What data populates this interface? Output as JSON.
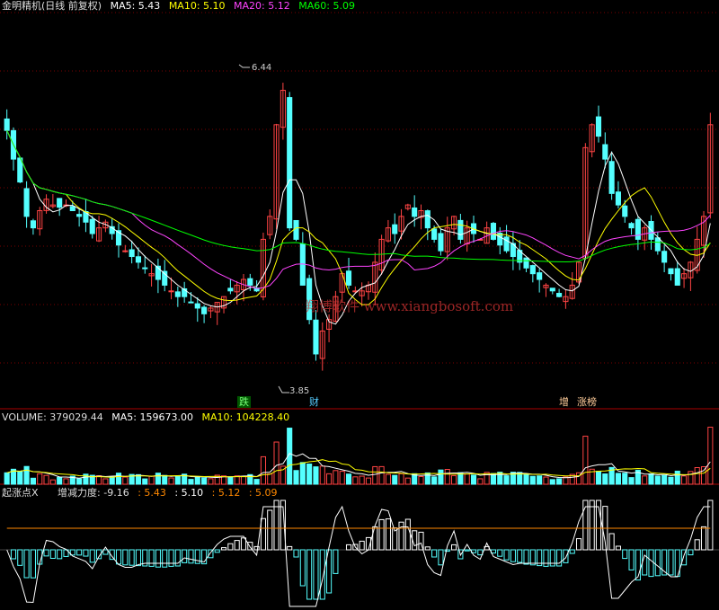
{
  "colors": {
    "up": "#ff4444",
    "down": "#54ffff",
    "ma5": "#ffffff",
    "ma10": "#ffff00",
    "ma20": "#ff44ff",
    "ma60": "#00ff00",
    "vol_ma5": "#ffffff",
    "vol_ma10": "#ffff00",
    "grid": "#7a0000"
  },
  "header": {
    "title": "金明精机(日线 前复权)",
    "ma5": "MA5: 5.43",
    "ma10": "MA10: 5.10",
    "ma20": "MA20: 5.12",
    "ma60": "MA60: 5.09"
  },
  "annotations": {
    "high": "6.44",
    "low": "3.85"
  },
  "event_tags": {
    "t1": "跌",
    "t2": "财",
    "t3": "增",
    "t4": "涨榜"
  },
  "watermark": "翔博软件 www.xiangbosoft.com",
  "volume_header": {
    "volume": "VOLUME: 379029.44",
    "ma5": "MA5: 159673.00",
    "ma10": "MA10: 104228.40"
  },
  "indicator_header": {
    "name": "起涨点X",
    "label": "增减力度: -9.16",
    "v1": ": 5.43",
    "v2": ": 5.10",
    "v3": ": 5.12",
    "v4": ": 5.09"
  },
  "chart_data": {
    "type": "candlestick",
    "price_range": [
      3.6,
      6.9
    ],
    "closes": [
      5.95,
      5.7,
      5.5,
      5.2,
      5.1,
      5.25,
      5.35,
      5.3,
      5.28,
      5.3,
      5.25,
      5.2,
      5.15,
      5.05,
      5.1,
      5.15,
      5.05,
      4.95,
      4.9,
      4.85,
      4.8,
      4.75,
      4.7,
      4.65,
      4.6,
      4.55,
      4.5,
      4.5,
      4.45,
      4.4,
      4.35,
      4.4,
      4.45,
      4.5,
      4.55,
      4.6,
      4.65,
      4.6,
      4.55,
      5.0,
      5.2,
      6.0,
      6.3,
      5.1,
      5.0,
      4.6,
      4.3,
      4.0,
      4.2,
      4.3,
      4.5,
      4.7,
      4.6,
      4.55,
      4.55,
      4.6,
      4.8,
      5.0,
      5.1,
      5.05,
      5.2,
      5.3,
      5.2,
      5.25,
      5.1,
      5.0,
      4.9,
      5.1,
      5.2,
      5.0,
      5.1,
      5.05,
      5.0,
      5.1,
      5.0,
      4.95,
      4.9,
      4.85,
      4.8,
      4.75,
      4.7,
      4.65,
      4.6,
      4.55,
      4.5,
      4.5,
      4.6,
      4.8,
      5.8,
      6.0,
      5.9,
      5.7,
      5.4,
      5.3,
      5.2,
      5.1,
      5.0,
      5.1,
      5.0,
      4.9,
      4.8,
      4.7,
      4.6,
      4.7,
      4.8,
      5.0,
      5.2,
      6.0
    ],
    "volume_range": [
      0,
      400000
    ],
    "volume_last": 379029.44,
    "indicator_last": -9.16
  }
}
